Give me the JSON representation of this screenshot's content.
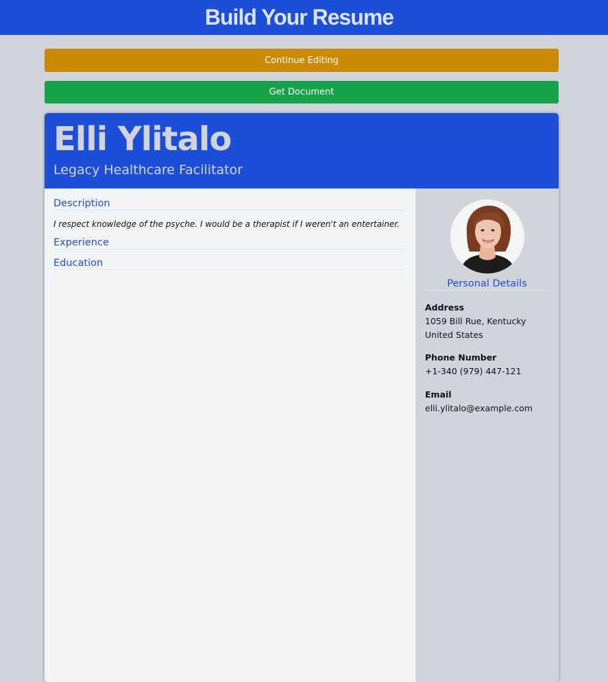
{
  "header": {
    "title": "Build Your Resume"
  },
  "actions": {
    "continue_label": "Continue Editing",
    "get_document_label": "Get Document"
  },
  "resume": {
    "name": "Elli Ylitalo",
    "job_title": "Legacy Healthcare Facilitator",
    "sections": {
      "description_heading": "Description",
      "description_text": "I respect knowledge of the psyche. I would be a therapist if I weren't an entertainer.",
      "experience_heading": "Experience",
      "education_heading": "Education"
    },
    "personal": {
      "heading": "Personal Details",
      "address_label": "Address",
      "address_value": "1059 Bill Rue, Kentucky United States",
      "phone_label": "Phone Number",
      "phone_value": "+1-340 (979) 447-121",
      "email_label": "Email",
      "email_value": "elli.ylitalo@example.com"
    }
  },
  "colors": {
    "primary": "#1d4ed8",
    "continue_button": "#ca8a04",
    "get_document_button": "#16a34a",
    "page_background": "#d1d5db"
  },
  "icons": {
    "avatar": "profile-photo"
  }
}
